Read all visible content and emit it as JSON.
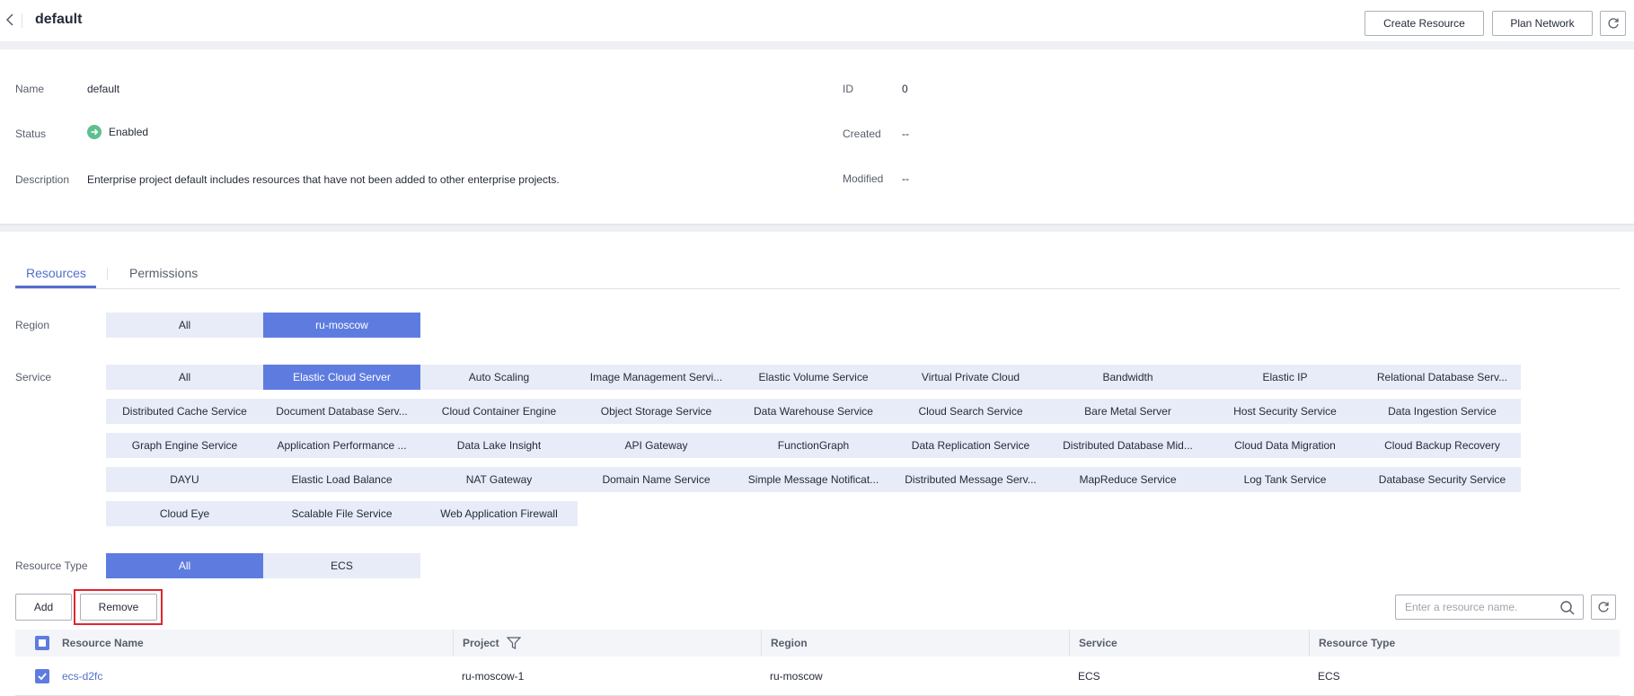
{
  "header": {
    "title": "default",
    "create_resource_label": "Create Resource",
    "plan_network_label": "Plan Network"
  },
  "info": {
    "name_label": "Name",
    "name_value": "default",
    "status_label": "Status",
    "status_value": "Enabled",
    "description_label": "Description",
    "description_value": "Enterprise project default includes resources that have not been added to other enterprise projects.",
    "id_label": "ID",
    "id_value": "0",
    "created_label": "Created",
    "created_value": "--",
    "modified_label": "Modified",
    "modified_value": "--"
  },
  "tabs": [
    {
      "label": "Resources",
      "active": true
    },
    {
      "label": "Permissions",
      "active": false
    }
  ],
  "filters": {
    "region_label": "Region",
    "regions": [
      "All",
      "ru-moscow"
    ],
    "selected_region": "ru-moscow",
    "service_label": "Service",
    "services": [
      "All",
      "Elastic Cloud Server",
      "Auto Scaling",
      "Image Management Servi...",
      "Elastic Volume Service",
      "Virtual Private Cloud",
      "Bandwidth",
      "Elastic IP",
      "Relational Database Serv...",
      "Distributed Cache Service",
      "Document Database Serv...",
      "Cloud Container Engine",
      "Object Storage Service",
      "Data Warehouse Service",
      "Cloud Search Service",
      "Bare Metal Server",
      "Host Security Service",
      "Data Ingestion Service",
      "Graph Engine Service",
      "Application Performance ...",
      "Data Lake Insight",
      "API Gateway",
      "FunctionGraph",
      "Data Replication Service",
      "Distributed Database Mid...",
      "Cloud Data Migration",
      "Cloud Backup Recovery",
      "DAYU",
      "Elastic Load Balance",
      "NAT Gateway",
      "Domain Name Service",
      "Simple Message Notificat...",
      "Distributed Message Serv...",
      "MapReduce Service",
      "Log Tank Service",
      "Database Security Service",
      "Cloud Eye",
      "Scalable File Service",
      "Web Application Firewall"
    ],
    "selected_service": "Elastic Cloud Server",
    "resource_type_label": "Resource Type",
    "resource_types": [
      "All",
      "ECS"
    ],
    "selected_resource_type": "All"
  },
  "toolbar": {
    "add_label": "Add",
    "remove_label": "Remove",
    "search_placeholder": "Enter a resource name."
  },
  "table": {
    "columns": [
      "Resource Name",
      "Project",
      "Region",
      "Service",
      "Resource Type"
    ],
    "rows": [
      {
        "resource_name": "ecs-d2fc",
        "project": "ru-moscow-1",
        "region": "ru-moscow",
        "service": "ECS",
        "resource_type": "ECS",
        "checked": true
      }
    ]
  },
  "colors": {
    "accent": "#5e7ce0",
    "chip_bg": "#e8ecf8",
    "link": "#526ecc",
    "status_enabled": "#5dbf8f",
    "highlight": "#e0262f"
  }
}
